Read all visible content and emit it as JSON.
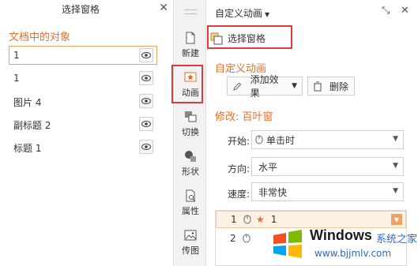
{
  "selection_pane": {
    "title": "选择窗格",
    "section_title": "文档中的对象",
    "objects": [
      {
        "label": "1"
      },
      {
        "label": "1"
      },
      {
        "label": "图片 4"
      },
      {
        "label": "副标题 2"
      },
      {
        "label": "标题 1"
      }
    ]
  },
  "tool_strip": {
    "items": [
      {
        "label": "新建",
        "icon": "new-slide-icon"
      },
      {
        "label": "动画",
        "icon": "animation-icon"
      },
      {
        "label": "切换",
        "icon": "transition-icon"
      },
      {
        "label": "形状",
        "icon": "shape-icon"
      },
      {
        "label": "属性",
        "icon": "property-icon"
      },
      {
        "label": "传图",
        "icon": "upload-image-icon"
      }
    ]
  },
  "animation_pane": {
    "title": "自定义动画",
    "select_pane_button": "选择窗格",
    "section_title": "自定义动画",
    "add_effect": "添加效果",
    "delete": "删除",
    "modify_title": "修改: 百叶窗",
    "start_label": "开始:",
    "start_value": "单击时",
    "direction_label": "方向:",
    "direction_value": "水平",
    "speed_label": "速度:",
    "speed_value": "非常快",
    "list": [
      {
        "num": "1",
        "text": "1"
      },
      {
        "num": "2",
        "text": ""
      }
    ]
  },
  "watermark": {
    "brand": "Windows",
    "cn": "系统之家",
    "url": "www.bjjmlv.com"
  },
  "colors": {
    "accent": "#e0712e",
    "highlight_box": "#e03a3a"
  }
}
